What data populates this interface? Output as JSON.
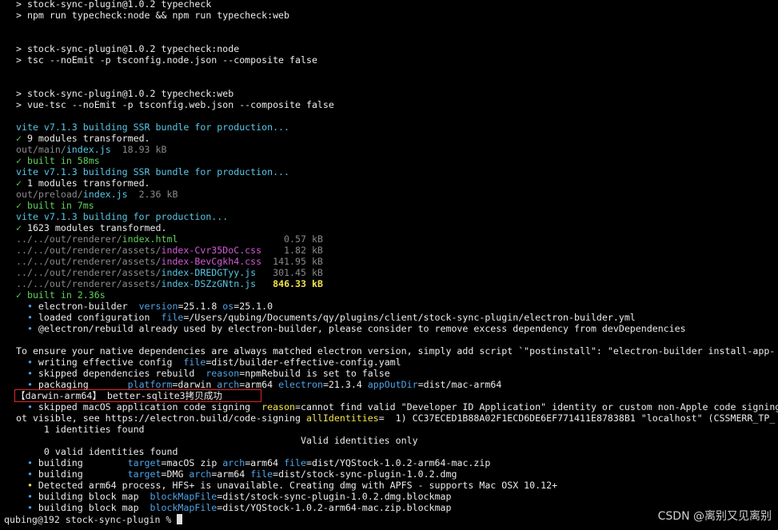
{
  "terminal": {
    "lines": [
      [
        {
          "t": "> stock-sync-plugin@1.0.2 typecheck",
          "c": "white"
        }
      ],
      [
        {
          "t": "> npm run typecheck:node && npm run typecheck:web",
          "c": "white"
        }
      ],
      [
        {
          "t": "",
          "c": "white"
        }
      ],
      [
        {
          "t": "",
          "c": "white"
        }
      ],
      [
        {
          "t": "> stock-sync-plugin@1.0.2 typecheck:node",
          "c": "white"
        }
      ],
      [
        {
          "t": "> tsc --noEmit -p tsconfig.node.json --composite false",
          "c": "white"
        }
      ],
      [
        {
          "t": "",
          "c": "white"
        }
      ],
      [
        {
          "t": "",
          "c": "white"
        }
      ],
      [
        {
          "t": "> stock-sync-plugin@1.0.2 typecheck:web",
          "c": "white"
        }
      ],
      [
        {
          "t": "> vue-tsc --noEmit -p tsconfig.web.json --composite false",
          "c": "white"
        }
      ],
      [
        {
          "t": "",
          "c": "white"
        }
      ],
      [
        {
          "t": "vite v7.1.3 building SSR bundle for production...",
          "c": "cyan"
        }
      ],
      [
        {
          "t": "✓ ",
          "c": "green"
        },
        {
          "t": "9 modules transformed.",
          "c": "white"
        }
      ],
      [
        {
          "t": "out/main/",
          "c": "gray"
        },
        {
          "t": "index.js",
          "c": "cyan"
        },
        {
          "t": "  18.93 kB",
          "c": "gray"
        }
      ],
      [
        {
          "t": "✓ built in 58ms",
          "c": "green"
        }
      ],
      [
        {
          "t": "vite v7.1.3 building SSR bundle for production...",
          "c": "cyan"
        }
      ],
      [
        {
          "t": "✓ ",
          "c": "green"
        },
        {
          "t": "1 modules transformed.",
          "c": "white"
        }
      ],
      [
        {
          "t": "out/preload/",
          "c": "gray"
        },
        {
          "t": "index.js",
          "c": "cyan"
        },
        {
          "t": "  2.36 kB",
          "c": "gray"
        }
      ],
      [
        {
          "t": "✓ built in 7ms",
          "c": "green"
        }
      ],
      [
        {
          "t": "vite v7.1.3 building for production...",
          "c": "cyan"
        }
      ],
      [
        {
          "t": "✓ ",
          "c": "green"
        },
        {
          "t": "1623 modules transformed.",
          "c": "white"
        }
      ],
      [
        {
          "t": "../../out/renderer/",
          "c": "gray"
        },
        {
          "t": "index.html",
          "c": "green"
        },
        {
          "t": "                   0.57 kB",
          "c": "gray"
        }
      ],
      [
        {
          "t": "../../out/renderer/assets/",
          "c": "gray"
        },
        {
          "t": "index-Cvr35DoC.css",
          "c": "mag"
        },
        {
          "t": "    1.82 kB",
          "c": "gray"
        }
      ],
      [
        {
          "t": "../../out/renderer/assets/",
          "c": "gray"
        },
        {
          "t": "index-BevCgkh4.css",
          "c": "mag"
        },
        {
          "t": "  141.95 kB",
          "c": "gray"
        }
      ],
      [
        {
          "t": "../../out/renderer/assets/",
          "c": "gray"
        },
        {
          "t": "index-DREDGTyy.js",
          "c": "cyan"
        },
        {
          "t": "   301.45 kB",
          "c": "gray"
        }
      ],
      [
        {
          "t": "../../out/renderer/assets/",
          "c": "gray"
        },
        {
          "t": "index-DSZzGNtn.js",
          "c": "cyan"
        },
        {
          "t": "   ",
          "c": "gray"
        },
        {
          "t": "846.33 kB",
          "c": "yellow"
        }
      ],
      [
        {
          "t": "✓ built in 2.36s",
          "c": "green"
        }
      ],
      [
        {
          "t": "  • ",
          "c": "blue"
        },
        {
          "t": "electron-builder  ",
          "c": "white"
        },
        {
          "t": "version",
          "c": "blue"
        },
        {
          "t": "=25.1.8 ",
          "c": "white"
        },
        {
          "t": "os",
          "c": "blue"
        },
        {
          "t": "=25.1.0",
          "c": "white"
        }
      ],
      [
        {
          "t": "  • ",
          "c": "blue"
        },
        {
          "t": "loaded configuration  ",
          "c": "white"
        },
        {
          "t": "file",
          "c": "blue"
        },
        {
          "t": "=/Users/qubing/Documents/qy/plugins/client/stock-sync-plugin/electron-builder.yml",
          "c": "white"
        }
      ],
      [
        {
          "t": "  • ",
          "c": "blue"
        },
        {
          "t": "@electron/rebuild already used by electron-builder, please consider to remove excess dependency from devDependencies",
          "c": "white"
        }
      ],
      [
        {
          "t": "",
          "c": "white"
        }
      ],
      [
        {
          "t": "To ensure your native dependencies are always matched electron version, simply add script `\"postinstall\": \"electron-builder install-app-",
          "c": "white"
        }
      ],
      [
        {
          "t": "  • ",
          "c": "blue"
        },
        {
          "t": "writing effective config  ",
          "c": "white"
        },
        {
          "t": "file",
          "c": "blue"
        },
        {
          "t": "=dist/builder-effective-config.yaml",
          "c": "white"
        }
      ],
      [
        {
          "t": "  • ",
          "c": "blue"
        },
        {
          "t": "skipped dependencies rebuild  ",
          "c": "white"
        },
        {
          "t": "reason",
          "c": "blue"
        },
        {
          "t": "=npmRebuild is set to false",
          "c": "white"
        }
      ],
      [
        {
          "t": "  • ",
          "c": "blue"
        },
        {
          "t": "packaging       ",
          "c": "white"
        },
        {
          "t": "platform",
          "c": "blue"
        },
        {
          "t": "=darwin ",
          "c": "white"
        },
        {
          "t": "arch",
          "c": "blue"
        },
        {
          "t": "=arm64 ",
          "c": "white"
        },
        {
          "t": "electron",
          "c": "blue"
        },
        {
          "t": "=21.3.4 ",
          "c": "white"
        },
        {
          "t": "appOutDir",
          "c": "blue"
        },
        {
          "t": "=dist/mac-arm64",
          "c": "white"
        }
      ],
      [
        {
          "t": "【darwin-arm64】 better-sqlite3拷贝成功",
          "c": "white"
        }
      ],
      [
        {
          "t": "  • ",
          "c": "blue"
        },
        {
          "t": "skipped macOS application code signing  ",
          "c": "white"
        },
        {
          "t": "reason",
          "c": "yellowplain"
        },
        {
          "t": "=cannot find valid \"Developer ID Application\" identity or custom non-Apple code signing",
          "c": "white"
        }
      ],
      [
        {
          "t": "ot visible, see https://electron.build/code-signing ",
          "c": "white"
        },
        {
          "t": "allIdentities",
          "c": "yellowplain"
        },
        {
          "t": "=  1) CC37ECED1B88A02F1ECD6DE6EF771411E87838B1 \"localhost\" (CSSMERR_TP_",
          "c": "white"
        }
      ],
      [
        {
          "t": "     1 identities found",
          "c": "white"
        }
      ],
      [
        {
          "t": "                                                   Valid identities only",
          "c": "white"
        }
      ],
      [
        {
          "t": "     0 valid identities found",
          "c": "white"
        }
      ],
      [
        {
          "t": "  • ",
          "c": "blue"
        },
        {
          "t": "building        ",
          "c": "white"
        },
        {
          "t": "target",
          "c": "blue"
        },
        {
          "t": "=macOS zip ",
          "c": "white"
        },
        {
          "t": "arch",
          "c": "blue"
        },
        {
          "t": "=arm64 ",
          "c": "white"
        },
        {
          "t": "file",
          "c": "blue"
        },
        {
          "t": "=dist/YQStock-1.0.2-arm64-mac.zip",
          "c": "white"
        }
      ],
      [
        {
          "t": "  • ",
          "c": "blue"
        },
        {
          "t": "building        ",
          "c": "white"
        },
        {
          "t": "target",
          "c": "blue"
        },
        {
          "t": "=DMG ",
          "c": "white"
        },
        {
          "t": "arch",
          "c": "blue"
        },
        {
          "t": "=arm64 ",
          "c": "white"
        },
        {
          "t": "file",
          "c": "blue"
        },
        {
          "t": "=dist/stock-sync-plugin-1.0.2.dmg",
          "c": "white"
        }
      ],
      [
        {
          "t": "  • ",
          "c": "yellowplain"
        },
        {
          "t": "Detected arm64 process, HFS+ is unavailable. Creating dmg with APFS - supports Mac OSX 10.12+",
          "c": "white"
        }
      ],
      [
        {
          "t": "  • ",
          "c": "blue"
        },
        {
          "t": "building block map  ",
          "c": "white"
        },
        {
          "t": "blockMapFile",
          "c": "blue"
        },
        {
          "t": "=dist/stock-sync-plugin-1.0.2.dmg.blockmap",
          "c": "white"
        }
      ],
      [
        {
          "t": "  • ",
          "c": "blue"
        },
        {
          "t": "building block map  ",
          "c": "white"
        },
        {
          "t": "blockMapFile",
          "c": "blue"
        },
        {
          "t": "=dist/YQStock-1.0.2-arm64-mac.zip.blockmap",
          "c": "white"
        }
      ]
    ],
    "prompt": "qubing@192 stock-sync-plugin % "
  },
  "watermark": "CSDN @离别又见离别",
  "colors": {
    "white": "#ececec",
    "cyan": "#5ac8e8",
    "green": "#61d25a",
    "gray": "#8a8a8a",
    "mag": "#d45bd8",
    "yellow": "#f2e34c",
    "yellowplain": "#f2e34c",
    "blue": "#4fa3e8"
  }
}
